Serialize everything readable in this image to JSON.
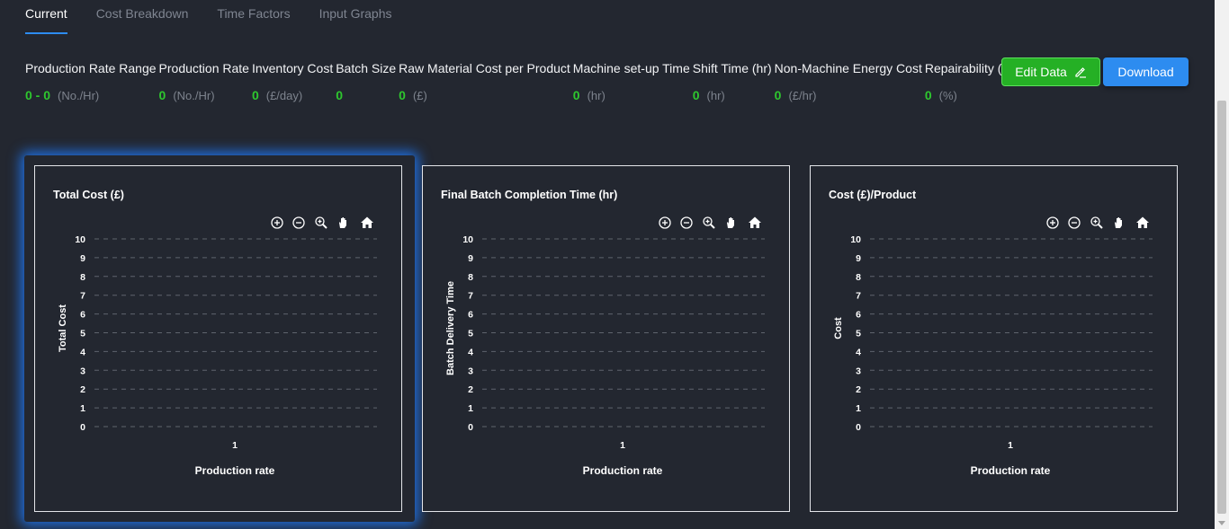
{
  "tabs": [
    {
      "label": "Current",
      "active": true
    },
    {
      "label": "Cost Breakdown",
      "active": false
    },
    {
      "label": "Time Factors",
      "active": false
    },
    {
      "label": "Input Graphs",
      "active": false
    }
  ],
  "metrics": [
    {
      "label": "Production Rate Range",
      "value": "0 - 0",
      "unit": "(No./Hr)"
    },
    {
      "label": "Production Rate",
      "value": "0",
      "unit": "(No./Hr)"
    },
    {
      "label": "Inventory Cost",
      "value": "0",
      "unit": "(£/day)"
    },
    {
      "label": "Batch Size",
      "value": "0",
      "unit": ""
    },
    {
      "label": "Raw Material Cost per Product",
      "value": "0",
      "unit": "(£)"
    },
    {
      "label": "Machine set-up Time",
      "value": "0",
      "unit": "(hr)"
    },
    {
      "label": "Shift Time (hr)",
      "value": "0",
      "unit": "(hr)"
    },
    {
      "label": "Non-Machine Energy Cost",
      "value": "0",
      "unit": "(£/hr)"
    },
    {
      "label": "Repairability (%)",
      "value": "0",
      "unit": "(%)"
    }
  ],
  "buttons": {
    "edit": "Edit Data",
    "download": "Download"
  },
  "colors": {
    "accent": "#2d8cf0",
    "value_green": "#2ec72e",
    "edit_green": "#25b025",
    "background": "#232730"
  },
  "toolbar_icons": [
    "zoom-in-icon",
    "zoom-out-icon",
    "zoom-select-icon",
    "pan-icon",
    "home-icon"
  ],
  "chart_data": [
    {
      "type": "line",
      "title": "Total Cost (£)",
      "xlabel": "Production rate",
      "ylabel": "Total Cost",
      "x": [
        1
      ],
      "series": [],
      "ylim": [
        0,
        10
      ],
      "yticks": [
        0,
        1,
        2,
        3,
        4,
        5,
        6,
        7,
        8,
        9,
        10
      ],
      "grid": true
    },
    {
      "type": "line",
      "title": "Final Batch Completion Time (hr)",
      "xlabel": "Production rate",
      "ylabel": "Batch Delivery Time",
      "x": [
        1
      ],
      "series": [],
      "ylim": [
        0,
        10
      ],
      "yticks": [
        0,
        1,
        2,
        3,
        4,
        5,
        6,
        7,
        8,
        9,
        10
      ],
      "grid": true
    },
    {
      "type": "line",
      "title": "Cost (£)/Product",
      "xlabel": "Production rate",
      "ylabel": "Cost",
      "x": [
        1
      ],
      "series": [],
      "ylim": [
        0,
        10
      ],
      "yticks": [
        0,
        1,
        2,
        3,
        4,
        5,
        6,
        7,
        8,
        9,
        10
      ],
      "grid": true
    }
  ]
}
